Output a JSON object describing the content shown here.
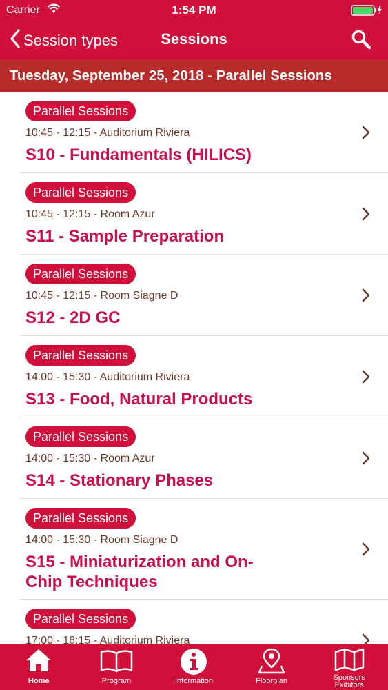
{
  "status_bar": {
    "carrier": "Carrier",
    "time": "1:54 PM"
  },
  "nav": {
    "back_label": "Session types",
    "title": "Sessions"
  },
  "date_header": "Tuesday, September 25, 2018 - Parallel Sessions",
  "sessions": [
    {
      "badge": "Parallel Sessions",
      "meta": "10:45 - 12:15 - Auditorium Riviera",
      "title": "S10 - Fundamentals (HILICS)"
    },
    {
      "badge": "Parallel Sessions",
      "meta": "10:45 - 12:15 - Room Azur",
      "title": "S11 - Sample Preparation"
    },
    {
      "badge": "Parallel Sessions",
      "meta": "10:45 - 12:15 - Room Siagne D",
      "title": "S12 - 2D GC"
    },
    {
      "badge": "Parallel Sessions",
      "meta": "14:00 - 15:30 - Auditorium Riviera",
      "title": "S13 - Food, Natural Products"
    },
    {
      "badge": "Parallel Sessions",
      "meta": "14:00 - 15:30 - Room Azur",
      "title": "S14 - Stationary Phases"
    },
    {
      "badge": "Parallel Sessions",
      "meta": "14:00 - 15:30 - Room Siagne D",
      "title": "S15 - Miniaturization and On-Chip Techniques"
    },
    {
      "badge": "Parallel Sessions",
      "meta": "17:00 - 18:15 - Auditorium Riviera",
      "title": ""
    }
  ],
  "tabs": [
    {
      "label": "Home",
      "icon": "home-icon",
      "active": true
    },
    {
      "label": "Program",
      "icon": "book-icon",
      "active": false
    },
    {
      "label": "Information",
      "icon": "info-icon",
      "active": false
    },
    {
      "label": "Floorplan",
      "icon": "map-pin-icon",
      "active": false
    },
    {
      "label_line1": "Sponsors",
      "label_line2": "Exibitors",
      "icon": "map-icon",
      "active": false
    }
  ],
  "colors": {
    "primary": "#d0103a",
    "date_header": "#b82b2b",
    "title_text": "#c8104a",
    "meta_text": "#6a3a2a"
  }
}
